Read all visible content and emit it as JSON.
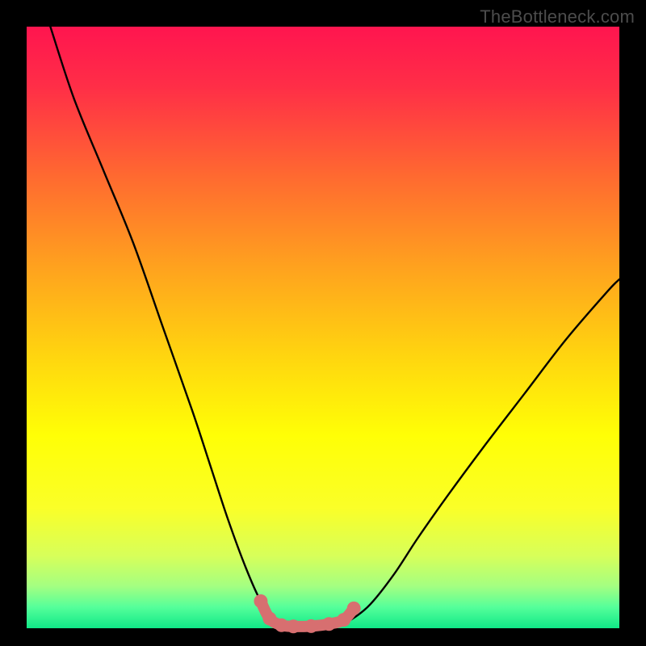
{
  "watermark": "TheBottleneck.com",
  "chart_data": {
    "type": "line",
    "title": "",
    "xlabel": "",
    "ylabel": "",
    "xlim": [
      0,
      100
    ],
    "ylim": [
      0,
      100
    ],
    "gradient_stops": [
      {
        "offset": 0.0,
        "color": "#ff154f"
      },
      {
        "offset": 0.1,
        "color": "#ff2e47"
      },
      {
        "offset": 0.25,
        "color": "#ff6a30"
      },
      {
        "offset": 0.4,
        "color": "#ffa21e"
      },
      {
        "offset": 0.55,
        "color": "#ffd60f"
      },
      {
        "offset": 0.68,
        "color": "#ffff06"
      },
      {
        "offset": 0.8,
        "color": "#faff28"
      },
      {
        "offset": 0.88,
        "color": "#d7ff5a"
      },
      {
        "offset": 0.93,
        "color": "#a4ff81"
      },
      {
        "offset": 0.965,
        "color": "#55ff9a"
      },
      {
        "offset": 1.0,
        "color": "#10e887"
      }
    ],
    "series": [
      {
        "name": "bottleneck-curve",
        "x": [
          4,
          8,
          13,
          18,
          23,
          28,
          31,
          34,
          37,
          39.5,
          42,
          44,
          46,
          49,
          53,
          55,
          58,
          62,
          66,
          71,
          77,
          84,
          91,
          98,
          100
        ],
        "values": [
          100,
          88,
          76,
          64,
          50,
          36,
          27,
          18,
          10,
          4.5,
          1.2,
          0.4,
          0.3,
          0.4,
          0.9,
          1.6,
          4.0,
          9,
          15,
          22,
          30,
          39,
          48,
          56,
          58
        ]
      }
    ],
    "highlight": {
      "name": "optimal-zone",
      "color": "#d76f70",
      "x": [
        39.5,
        41,
        43,
        45,
        48,
        51,
        53.5,
        55.2
      ],
      "values": [
        4.5,
        1.6,
        0.5,
        0.3,
        0.35,
        0.7,
        1.4,
        3.3
      ]
    }
  }
}
